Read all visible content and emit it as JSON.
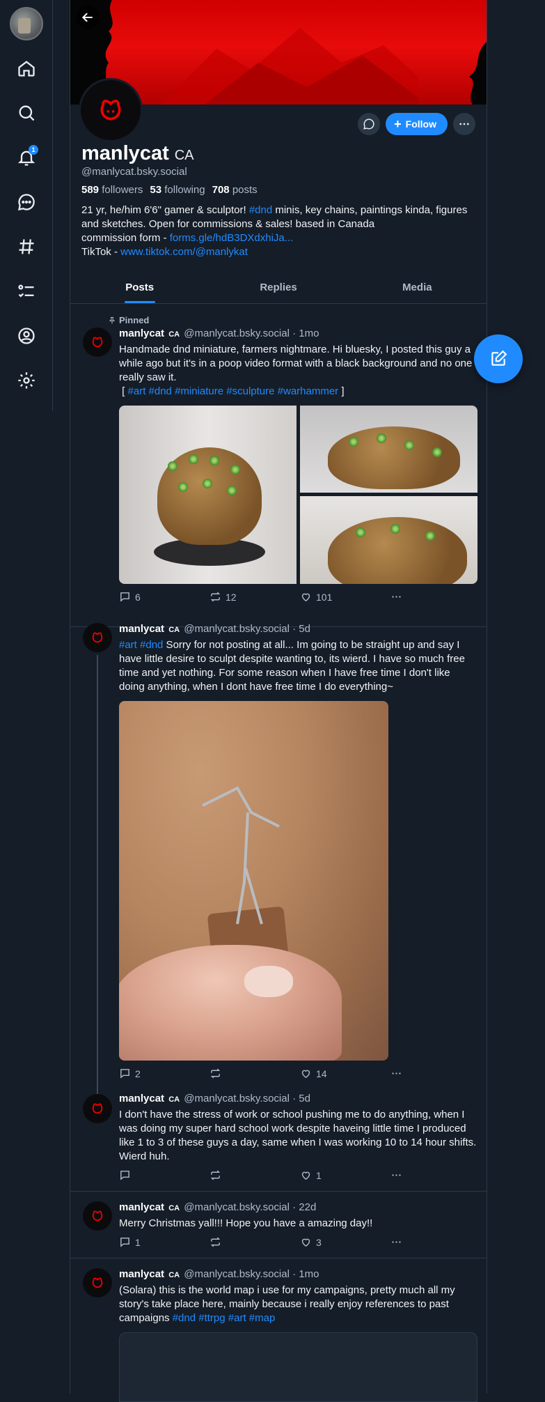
{
  "profile": {
    "display_name": "manlycat",
    "name_flag": "CA",
    "handle": "@manlycat.bsky.social",
    "followers_count": "589",
    "followers_label": "followers",
    "following_count": "53",
    "following_label": "following",
    "posts_count": "708",
    "posts_label": "posts",
    "bio_line1_pre": "21 yr, he/him 6'6\" gamer & sculptor! ",
    "bio_tag_dnd": "#dnd",
    "bio_line1_post": " minis, key chains, paintings kinda, figures and sketches. Open for commissions & sales! based in Canada",
    "bio_commission_pre": "commission form - ",
    "bio_commission_link": "forms.gle/hdB3DXdxhiJa...",
    "bio_tiktok_pre": "TikTok - ",
    "bio_tiktok_link": "www.tiktok.com/@manlykat",
    "follow_label": "Follow"
  },
  "tabs": [
    {
      "label": "Posts"
    },
    {
      "label": "Replies"
    },
    {
      "label": "Media"
    }
  ],
  "posts": [
    {
      "pinned_label": "Pinned",
      "name": "manlycat",
      "flag": "CA",
      "meta": "@manlycat.bsky.social · 1mo",
      "text": "Handmade dnd miniature, farmers nightmare. Hi bluesky, I posted this guy a while ago but it's in a poop video format with a black background and no one really saw it.",
      "tags_open": "[ ",
      "tags": "#art #dnd #miniature #sculpture #warhammer",
      "tags_close": " ]",
      "replies": "6",
      "reposts": "12",
      "likes": "101"
    },
    {
      "name": "manlycat",
      "flag": "CA",
      "meta": "@manlycat.bsky.social · 5d",
      "tags": "#art #dnd",
      "text": " Sorry for not posting at all... Im going to be straight up and say I have little desire to sculpt despite wanting to, its wierd. I have so much free time and yet nothing. For some reason when I have free time I don't like doing anything, when I dont have free time I do everything~",
      "replies": "2",
      "reposts": "",
      "likes": "14"
    },
    {
      "name": "manlycat",
      "flag": "CA",
      "meta": "@manlycat.bsky.social · 5d",
      "text": "I don't have the stress of work or school pushing me to do anything, when I was doing my super hard school work despite haveing little time I produced like 1 to 3 of these guys a day, same when I was working 10 to 14 hour shifts. Wierd huh.",
      "replies": "",
      "reposts": "",
      "likes": "1"
    },
    {
      "name": "manlycat",
      "flag": "CA",
      "meta": "@manlycat.bsky.social · 22d",
      "text": "Merry Christmas yall!!! Hope you have a amazing day!!",
      "replies": "1",
      "reposts": "",
      "likes": "3"
    },
    {
      "name": "manlycat",
      "flag": "CA",
      "meta": "@manlycat.bsky.social · 1mo",
      "text": "(Solara) this is the world map i use for my campaigns, pretty much all my story's take place here, mainly because i really enjoy references to past campaigns ",
      "tags": " #dnd #ttrpg #art #map"
    }
  ],
  "notifications_badge": "1",
  "colors": {
    "background": "#151d28",
    "accent": "#208bfe",
    "muted_text": "#aebbc9",
    "border": "#2c3a4a"
  },
  "icons": {
    "nav": [
      "home-icon",
      "search-icon",
      "bell-icon",
      "chat-icon",
      "hashtag-icon",
      "list-icon",
      "profile-icon",
      "gear-icon"
    ],
    "actions": [
      "reply-icon",
      "repost-icon",
      "like-icon",
      "more-icon"
    ]
  }
}
